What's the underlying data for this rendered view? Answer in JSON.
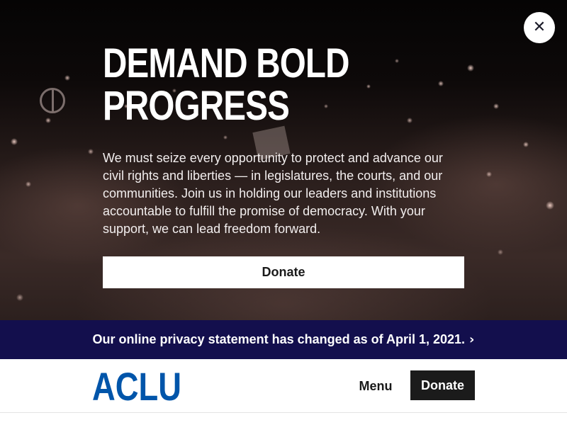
{
  "modal": {
    "title": "DEMAND BOLD PROGRESS",
    "body": "We must seize every opportunity to protect and advance our civil rights and liberties — in legislatures, the courts, and our communities. Join us in holding our leaders and institutions accountable to fulfill the promise of democracy. With your support, we can lead freedom forward.",
    "donate_label": "Donate",
    "close_icon": "✕"
  },
  "privacy_banner": {
    "text": "Our online privacy statement has changed as of April 1, 2021.",
    "chevron": "›"
  },
  "header": {
    "logo_text": "ACLU",
    "menu_label": "Menu",
    "donate_label": "Donate"
  },
  "colors": {
    "brand_blue": "#0055AA",
    "banner_navy": "#130F4D",
    "donate_dark": "#1B1B1B"
  },
  "icons": {
    "close": "close-icon",
    "banner_arrow": "chevron-right-icon"
  }
}
